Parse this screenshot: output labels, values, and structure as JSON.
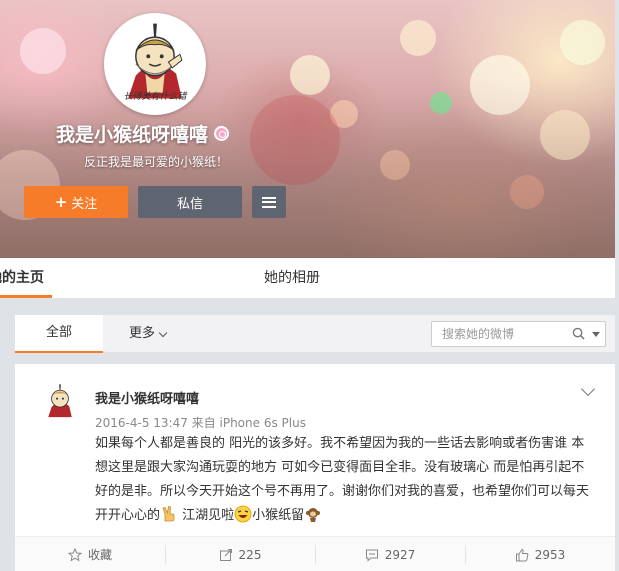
{
  "profile": {
    "username": "我是小猴纸呀嘻嘻",
    "bio": "反正我是最可爱的小猴纸！",
    "avatar_caption": "长得美有什么错",
    "follow_label": "关注",
    "message_label": "私信"
  },
  "nav": {
    "home_label": "她的主页",
    "album_label": "她的相册"
  },
  "filter": {
    "all_label": "全部",
    "more_label": "更多",
    "search_placeholder": "搜索她的微博"
  },
  "post": {
    "author": "我是小猴纸呀嘻嘻",
    "meta": "2016-4-5 13:47 来自 iPhone 6s Plus",
    "text_main": "如果每个人都是善良的 阳光的该多好。我不希望因为我的一些话去影响或者伤害谁 本想这里是跟大家沟通玩耍的地方 可如今已变得面目全非。没有玻璃心 而是怕再引起不好的是非。所以今天开始这个号不再用了。谢谢你们对我的喜爱，也希望你们可以每天开开心心的",
    "text_part2": "江湖见啦",
    "text_part3": "小猴纸留",
    "actions": {
      "favorite_label": "收藏",
      "repost_count": "225",
      "comment_count": "2927",
      "like_count": "2953"
    }
  },
  "colors": {
    "accent": "#f77c2a",
    "button_dark": "#5e6470"
  }
}
